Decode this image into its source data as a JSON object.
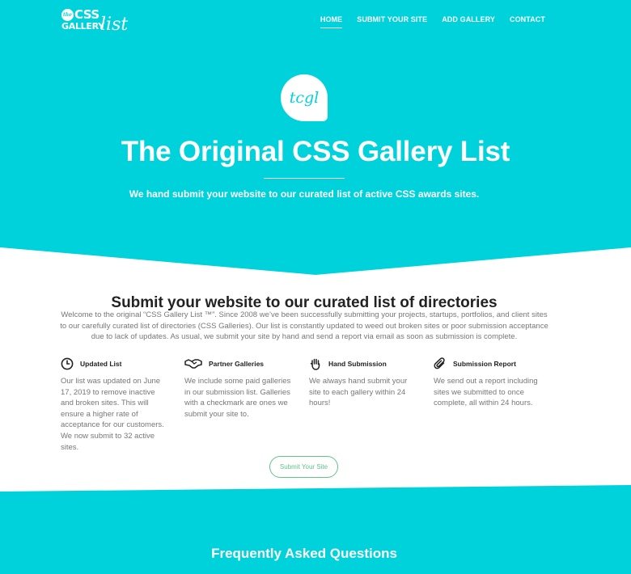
{
  "brand": {
    "logo_the": "the",
    "logo_css": "CSS",
    "logo_gallery": "GALLERY",
    "logo_list": "list",
    "badge_text": "tcgl",
    "accent_color": "#00d2dc",
    "button_color": "#62c389"
  },
  "nav": {
    "items": [
      {
        "label": "HOME",
        "active": true
      },
      {
        "label": "SUBMIT YOUR SITE",
        "active": false
      },
      {
        "label": "ADD GALLERY",
        "active": false
      },
      {
        "label": "CONTACT",
        "active": false
      }
    ]
  },
  "hero": {
    "title": "The Original CSS Gallery List",
    "subtitle": "We hand submit your website to our curated list of active CSS awards sites."
  },
  "main": {
    "title": "Submit your website to our curated list of directories",
    "intro": "Welcome to the original “CSS Gallery List ™”.  Since 2008 we’ve been successfully submitting your projects, startups, portfolios, and client sites to our carefully curated list of directories (CSS Galleries).  Our list is constantly updated to weed out broken sites or poor submission acceptance due to lack of updates.  As usual, we submit your site by hand and send a report via email as soon as submission is complete.",
    "features": [
      {
        "icon": "clock-icon",
        "title": "Updated List",
        "body": "Our list was updated on June 17, 2019 to remove inactive and broken sites. This will ensure a higher rate of acceptance for our customers. We now submit to 32 active sites."
      },
      {
        "icon": "handshake-icon",
        "title": "Partner Galleries",
        "body": "We include some paid galleries in our submission list. Galleries with a checkmark are ones we submit your site to."
      },
      {
        "icon": "hand-icon",
        "title": "Hand Submission",
        "body": "We always hand submit your site to each gallery within 24 hours!"
      },
      {
        "icon": "paperclip-icon",
        "title": "Submission Report",
        "body": "We send out a report including sites we submitted to once complete, all within 24 hours."
      }
    ],
    "submit_button": "Submit Your Site"
  },
  "faq": {
    "title": "Frequently Asked Questions"
  }
}
